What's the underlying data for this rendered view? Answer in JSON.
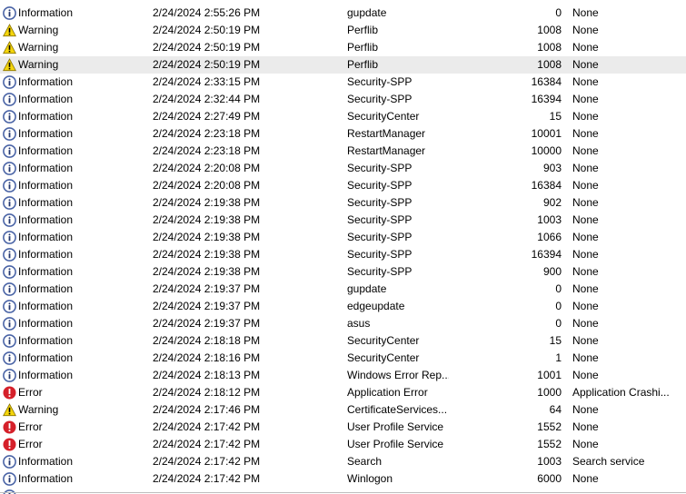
{
  "icons": {
    "info": "info-icon",
    "warning": "warning-icon",
    "error": "error-icon"
  },
  "colors": {
    "info_ring": "#4a64a6",
    "warning_fill": "#f5d60b",
    "error_fill": "#d5202a",
    "selected_row_bg": "#ebebeb"
  },
  "rows": [
    {
      "level": "Information",
      "icon": "info",
      "date": "2/24/2024 2:55:26 PM",
      "source": "gupdate",
      "event_id": "0",
      "category": "None"
    },
    {
      "level": "Warning",
      "icon": "warning",
      "date": "2/24/2024 2:50:19 PM",
      "source": "Perflib",
      "event_id": "1008",
      "category": "None"
    },
    {
      "level": "Warning",
      "icon": "warning",
      "date": "2/24/2024 2:50:19 PM",
      "source": "Perflib",
      "event_id": "1008",
      "category": "None"
    },
    {
      "level": "Warning",
      "icon": "warning",
      "date": "2/24/2024 2:50:19 PM",
      "source": "Perflib",
      "event_id": "1008",
      "category": "None",
      "selected": true
    },
    {
      "level": "Information",
      "icon": "info",
      "date": "2/24/2024 2:33:15 PM",
      "source": "Security-SPP",
      "event_id": "16384",
      "category": "None"
    },
    {
      "level": "Information",
      "icon": "info",
      "date": "2/24/2024 2:32:44 PM",
      "source": "Security-SPP",
      "event_id": "16394",
      "category": "None"
    },
    {
      "level": "Information",
      "icon": "info",
      "date": "2/24/2024 2:27:49 PM",
      "source": "SecurityCenter",
      "event_id": "15",
      "category": "None"
    },
    {
      "level": "Information",
      "icon": "info",
      "date": "2/24/2024 2:23:18 PM",
      "source": "RestartManager",
      "event_id": "10001",
      "category": "None"
    },
    {
      "level": "Information",
      "icon": "info",
      "date": "2/24/2024 2:23:18 PM",
      "source": "RestartManager",
      "event_id": "10000",
      "category": "None"
    },
    {
      "level": "Information",
      "icon": "info",
      "date": "2/24/2024 2:20:08 PM",
      "source": "Security-SPP",
      "event_id": "903",
      "category": "None"
    },
    {
      "level": "Information",
      "icon": "info",
      "date": "2/24/2024 2:20:08 PM",
      "source": "Security-SPP",
      "event_id": "16384",
      "category": "None"
    },
    {
      "level": "Information",
      "icon": "info",
      "date": "2/24/2024 2:19:38 PM",
      "source": "Security-SPP",
      "event_id": "902",
      "category": "None"
    },
    {
      "level": "Information",
      "icon": "info",
      "date": "2/24/2024 2:19:38 PM",
      "source": "Security-SPP",
      "event_id": "1003",
      "category": "None"
    },
    {
      "level": "Information",
      "icon": "info",
      "date": "2/24/2024 2:19:38 PM",
      "source": "Security-SPP",
      "event_id": "1066",
      "category": "None"
    },
    {
      "level": "Information",
      "icon": "info",
      "date": "2/24/2024 2:19:38 PM",
      "source": "Security-SPP",
      "event_id": "16394",
      "category": "None"
    },
    {
      "level": "Information",
      "icon": "info",
      "date": "2/24/2024 2:19:38 PM",
      "source": "Security-SPP",
      "event_id": "900",
      "category": "None"
    },
    {
      "level": "Information",
      "icon": "info",
      "date": "2/24/2024 2:19:37 PM",
      "source": "gupdate",
      "event_id": "0",
      "category": "None"
    },
    {
      "level": "Information",
      "icon": "info",
      "date": "2/24/2024 2:19:37 PM",
      "source": "edgeupdate",
      "event_id": "0",
      "category": "None"
    },
    {
      "level": "Information",
      "icon": "info",
      "date": "2/24/2024 2:19:37 PM",
      "source": "asus",
      "event_id": "0",
      "category": "None"
    },
    {
      "level": "Information",
      "icon": "info",
      "date": "2/24/2024 2:18:18 PM",
      "source": "SecurityCenter",
      "event_id": "15",
      "category": "None"
    },
    {
      "level": "Information",
      "icon": "info",
      "date": "2/24/2024 2:18:16 PM",
      "source": "SecurityCenter",
      "event_id": "1",
      "category": "None"
    },
    {
      "level": "Information",
      "icon": "info",
      "date": "2/24/2024 2:18:13 PM",
      "source": "Windows Error Rep...",
      "event_id": "1001",
      "category": "None"
    },
    {
      "level": "Error",
      "icon": "error",
      "date": "2/24/2024 2:18:12 PM",
      "source": "Application Error",
      "event_id": "1000",
      "category": "Application Crashi..."
    },
    {
      "level": "Warning",
      "icon": "warning",
      "date": "2/24/2024 2:17:46 PM",
      "source": "CertificateServices...",
      "event_id": "64",
      "category": "None"
    },
    {
      "level": "Error",
      "icon": "error",
      "date": "2/24/2024 2:17:42 PM",
      "source": "User Profile Service",
      "event_id": "1552",
      "category": "None"
    },
    {
      "level": "Error",
      "icon": "error",
      "date": "2/24/2024 2:17:42 PM",
      "source": "User Profile Service",
      "event_id": "1552",
      "category": "None"
    },
    {
      "level": "Information",
      "icon": "info",
      "date": "2/24/2024 2:17:42 PM",
      "source": "Search",
      "event_id": "1003",
      "category": "Search service"
    },
    {
      "level": "Information",
      "icon": "info",
      "date": "2/24/2024 2:17:42 PM",
      "source": "Winlogon",
      "event_id": "6000",
      "category": "None"
    },
    {
      "level": "",
      "icon": "info",
      "date": "",
      "source": "",
      "event_id": "",
      "category": ""
    }
  ]
}
